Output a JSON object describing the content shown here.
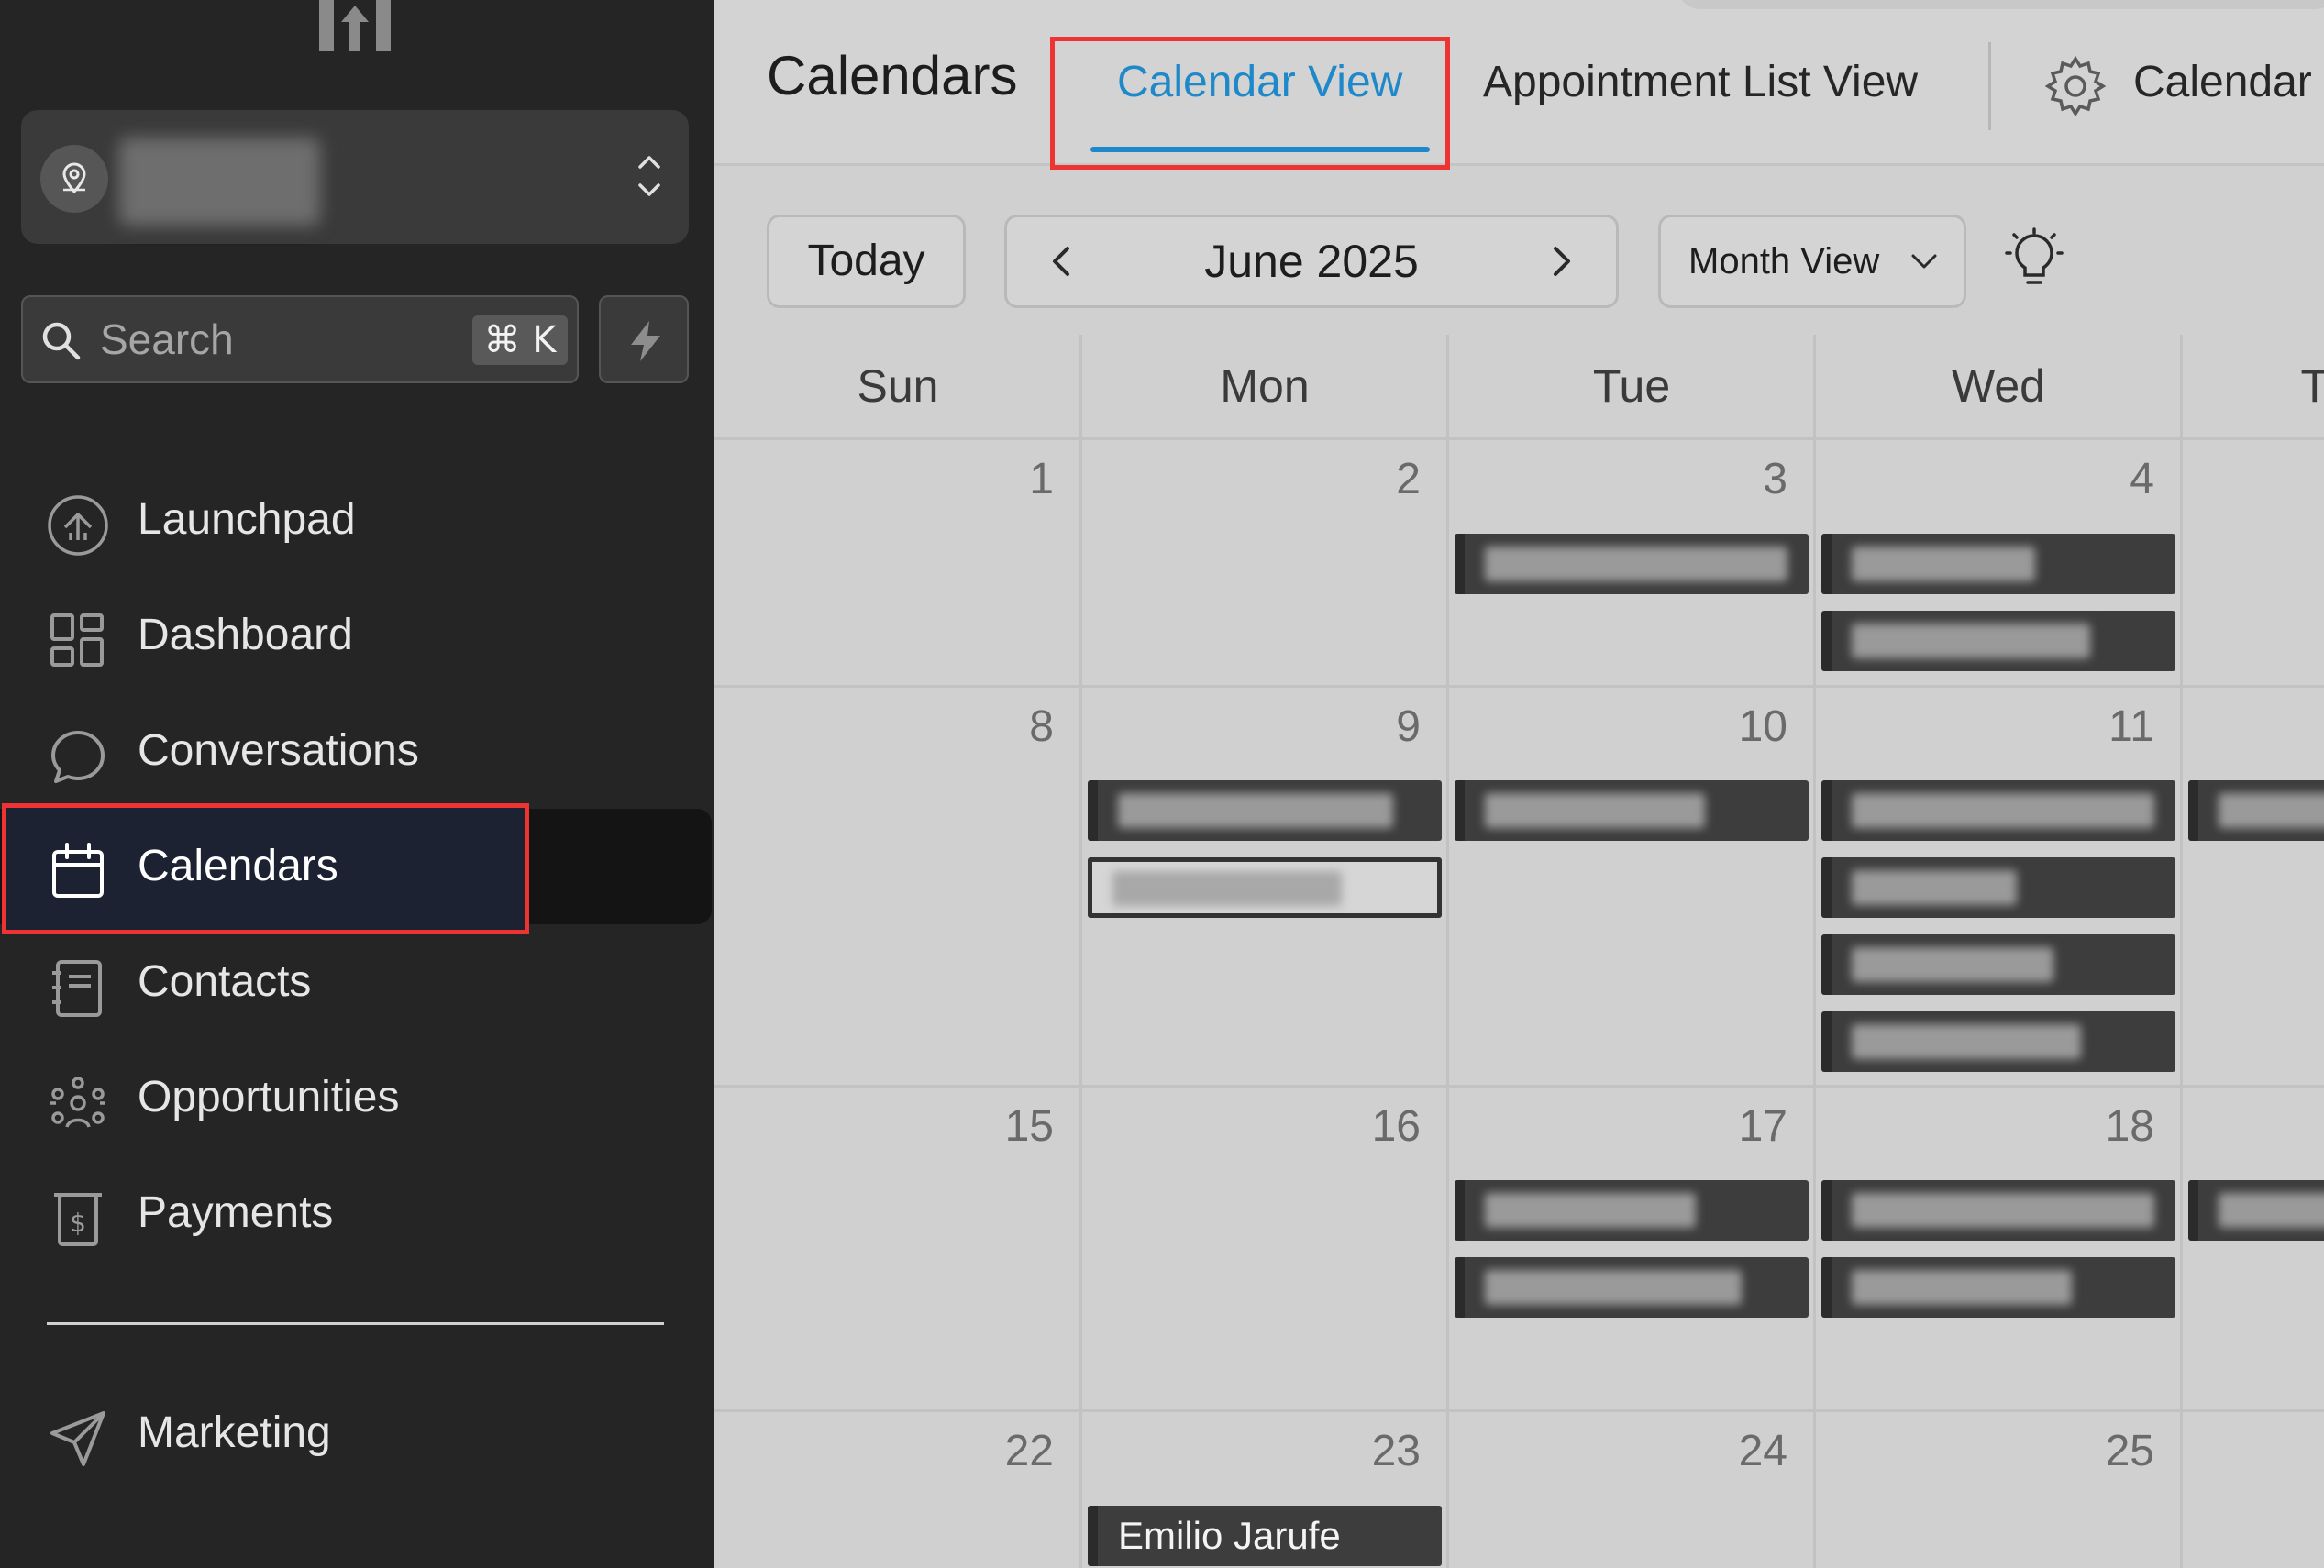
{
  "sidebar": {
    "search_placeholder": "Search",
    "search_shortcut": "⌘ K",
    "nav": [
      {
        "label": "Launchpad",
        "icon": "launchpad-icon"
      },
      {
        "label": "Dashboard",
        "icon": "dashboard-icon"
      },
      {
        "label": "Conversations",
        "icon": "conversations-icon"
      },
      {
        "label": "Calendars",
        "icon": "calendar-icon",
        "active": true
      },
      {
        "label": "Contacts",
        "icon": "contacts-icon"
      },
      {
        "label": "Opportunities",
        "icon": "opportunities-icon"
      },
      {
        "label": "Payments",
        "icon": "payments-icon"
      }
    ],
    "marketing": {
      "label": "Marketing",
      "icon": "send-icon"
    }
  },
  "header": {
    "title": "Calendars",
    "tabs": [
      {
        "label": "Calendar View",
        "active": true
      },
      {
        "label": "Appointment List View"
      },
      {
        "label": "Calendar"
      }
    ]
  },
  "toolbar": {
    "today_label": "Today",
    "month_label": "June 2025",
    "view_label": "Month View"
  },
  "calendar": {
    "weekdays": [
      "Sun",
      "Mon",
      "Tue",
      "Wed",
      "T"
    ],
    "weeks": [
      [
        "1",
        "2",
        "3",
        "4"
      ],
      [
        "8",
        "9",
        "10",
        "11"
      ],
      [
        "15",
        "16",
        "17",
        "18"
      ],
      [
        "22",
        "23",
        "24",
        "25"
      ]
    ],
    "visible_event": "Emilio Jarufe"
  },
  "colors": {
    "accent": "#1e88c9",
    "highlight_outline": "#ee3333",
    "sidebar_bg": "#252525",
    "event_bg": "#3d3d3d"
  }
}
